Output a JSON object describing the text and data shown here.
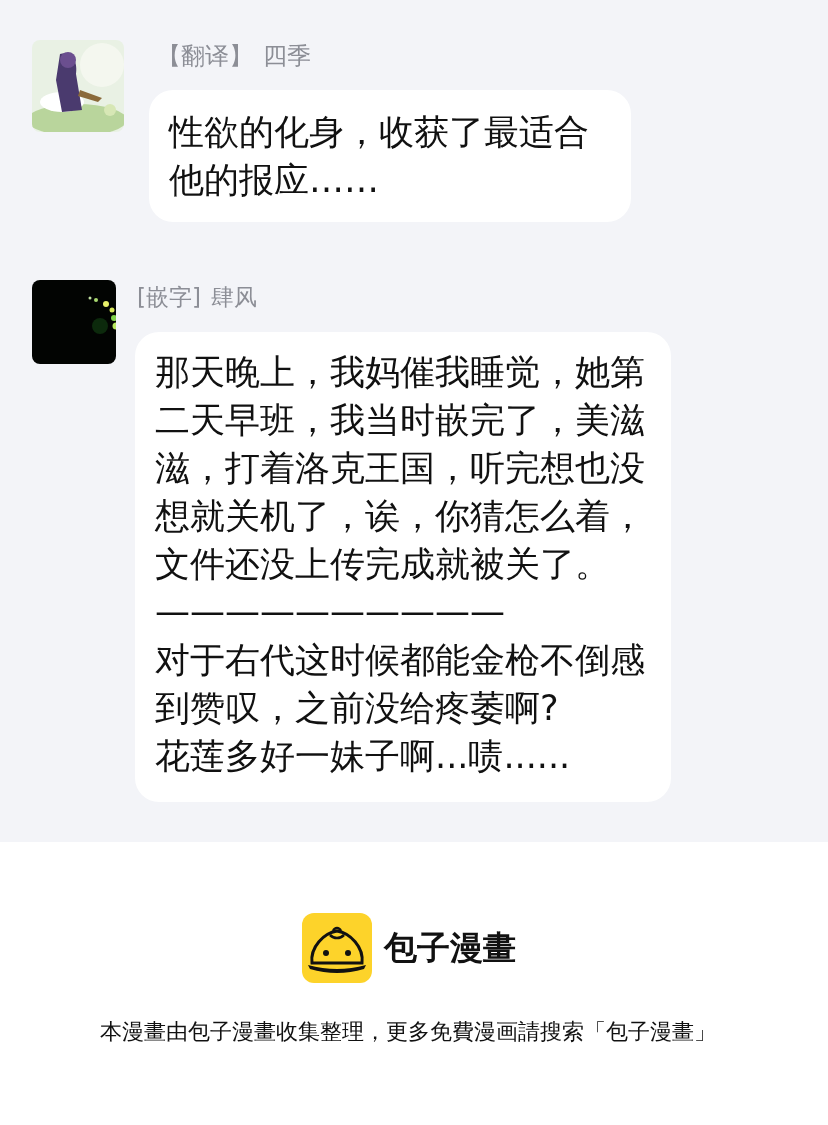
{
  "messages": [
    {
      "tag": "【翻译】",
      "name": "四季",
      "avatar": {
        "kind": "picture"
      },
      "paragraphs": [
        "性欲的化身，收获了最适合他的报应……"
      ]
    },
    {
      "tag": "[嵌字]",
      "name": "肆风",
      "avatar": {
        "kind": "picture"
      },
      "paragraphs": [
        "那天晚上，我妈催我睡觉，她第二天早班，我当时嵌完了，美滋滋，打着洛克王国，听完想也没想就关机了，诶，你猜怎么着，文件还没上传完成就被关了。",
        "——————————",
        "对于右代这时候都能金枪不倒感到赞叹，之前没给疼萎啊?",
        "花莲多好一妹子啊...啧......"
      ]
    }
  ],
  "footer": {
    "site_name": "包子漫畫",
    "notice": "本漫畫由包子漫畫收集整理，更多免費漫画請搜索「包子漫畫」"
  }
}
